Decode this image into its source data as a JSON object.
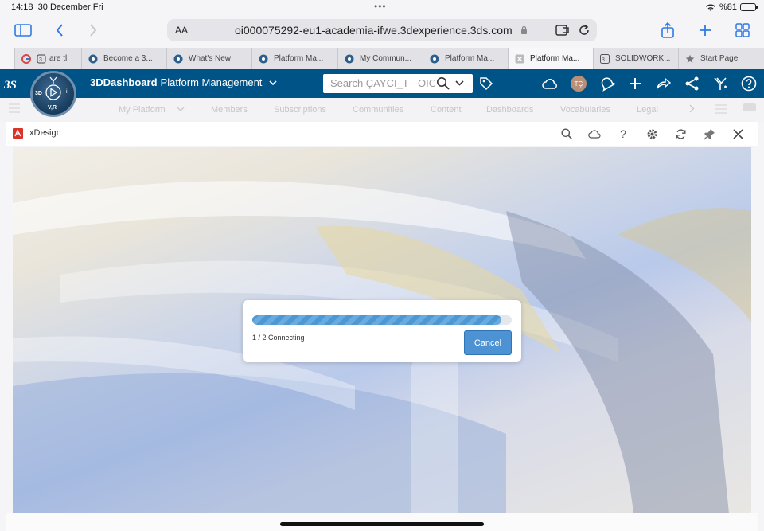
{
  "status_bar": {
    "time": "14:18",
    "date": "30 December Fri",
    "battery_text": "%81",
    "battery_level": 0.81
  },
  "browser": {
    "aa_label": "AA",
    "url": "oi000075292-eu1-academia-ifwe.3dexperience.3ds.com",
    "tabs": [
      {
        "label": "are tl",
        "icon": "google-icon"
      },
      {
        "label": "Become a 3...",
        "icon": "3dexperience-icon"
      },
      {
        "label": "What's New",
        "icon": "3dexperience-icon"
      },
      {
        "label": "Platform Ma...",
        "icon": "3dexperience-icon"
      },
      {
        "label": "My Commun...",
        "icon": "3dexperience-icon"
      },
      {
        "label": "Platform Ma...",
        "icon": "3dexperience-icon"
      },
      {
        "label": "Platform Ma...",
        "icon": "close-icon"
      },
      {
        "label": "SOLIDWORK...",
        "icon": "solidworks-icon"
      },
      {
        "label": "Start Page",
        "icon": "star-icon"
      }
    ],
    "active_tab": 6
  },
  "app": {
    "brand": "3DDashboard",
    "section": "Platform Management",
    "search_placeholder": "Search ÇAYCI_T - OIC",
    "avatar_initials": "TÇ",
    "compass_left": "3D",
    "compass_bottom": "V,R",
    "subnav": [
      "My Platform",
      "Members",
      "Subscriptions",
      "Communities",
      "Content",
      "Dashboards",
      "Vocabularies",
      "Legal"
    ]
  },
  "widget": {
    "title": "xDesign"
  },
  "dialog": {
    "progress_text": "1 / 2  Connecting",
    "cancel_label": "Cancel",
    "progress": 0.96
  },
  "colors": {
    "appbar": "#005386",
    "accent": "#2f7ae5",
    "progress": "#4d97d3"
  }
}
